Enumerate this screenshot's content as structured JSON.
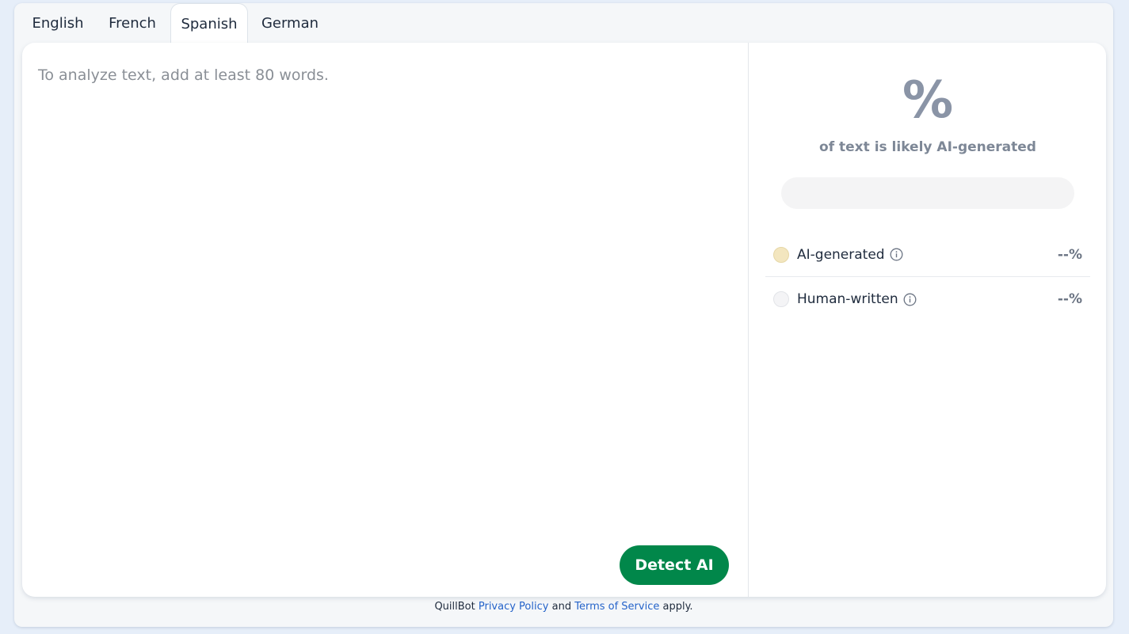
{
  "tabs": [
    {
      "label": "English",
      "active": false
    },
    {
      "label": "French",
      "active": false
    },
    {
      "label": "Spanish",
      "active": true
    },
    {
      "label": "German",
      "active": false
    }
  ],
  "editor": {
    "placeholder": "To analyze text, add at least 80 words.",
    "value": ""
  },
  "detect_button": {
    "label": "Detect AI"
  },
  "result": {
    "percent_symbol": "%",
    "subtitle": "of text is likely AI-generated",
    "ai_fraction": 0,
    "legend": [
      {
        "label": "AI-generated",
        "value": "--%",
        "color": "#f3e6bf"
      },
      {
        "label": "Human-written",
        "value": "--%",
        "color": "#f4f4f6"
      }
    ]
  },
  "footer": {
    "brand": "QuillBot",
    "privacy": "Privacy Policy",
    "and": "and",
    "terms": "Terms of Service",
    "suffix": "apply."
  },
  "colors": {
    "primary_button": "#01874a",
    "link": "#2563c9",
    "page_background": "#e6eef9"
  }
}
